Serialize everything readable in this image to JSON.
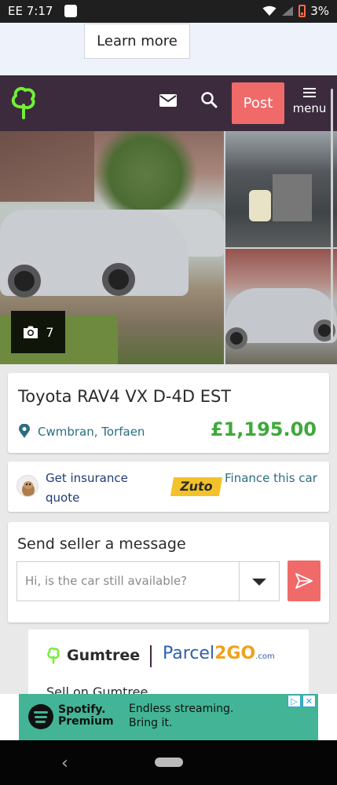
{
  "status_bar": {
    "carrier_time": "EE 7:17",
    "battery": "3%"
  },
  "top_ad": {
    "learn_more": "Learn more"
  },
  "header": {
    "post": "Post",
    "menu": "menu"
  },
  "photos": {
    "count": "7"
  },
  "listing": {
    "title": "Toyota RAV4 VX D-4D EST",
    "location": "Cwmbran, Torfaen",
    "price": "£1,195.00"
  },
  "finance": {
    "insurance": "Get insurance quote",
    "zuto": "Zuto",
    "finance": "Finance this car"
  },
  "message": {
    "title": "Send seller a message",
    "placeholder": "Hi, is the car still available?"
  },
  "promo": {
    "gumtree": "Gumtree",
    "parcel_a": "Parcel",
    "parcel_b": "2GO",
    "parcel_c": ".com",
    "sub": "Sell on Gumtree"
  },
  "bottom_ad": {
    "brand_line1": "Spotify.",
    "brand_line2": "Premium",
    "text": "Endless streaming. Bring it."
  },
  "colors": {
    "header": "#3b2b3d",
    "accent": "#f06a6a",
    "price": "#3ea93a",
    "logo": "#72ef36"
  }
}
